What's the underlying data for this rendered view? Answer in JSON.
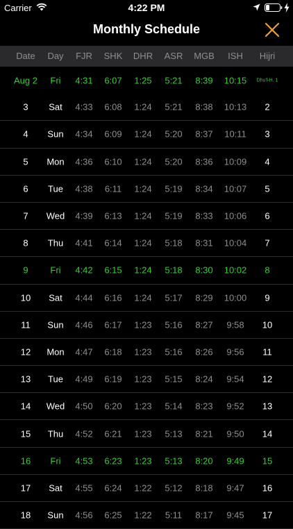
{
  "status": {
    "carrier": "Carrier",
    "time": "4:22 PM"
  },
  "nav": {
    "title": "Monthly Schedule"
  },
  "columns": [
    "Date",
    "Day",
    "FJR",
    "SHK",
    "DHR",
    "ASR",
    "MGB",
    "ISH",
    "Hijri"
  ],
  "rows": [
    {
      "date": "Aug 2",
      "day": "Fri",
      "fjr": "4:31",
      "shk": "6:07",
      "dhr": "1:25",
      "asr": "5:21",
      "mgb": "8:39",
      "ish": "10:15",
      "hijri": "Dhu'l-H. 1",
      "highlight": true
    },
    {
      "date": "3",
      "day": "Sat",
      "fjr": "4:33",
      "shk": "6:08",
      "dhr": "1:24",
      "asr": "5:21",
      "mgb": "8:38",
      "ish": "10:13",
      "hijri": "2"
    },
    {
      "date": "4",
      "day": "Sun",
      "fjr": "4:34",
      "shk": "6:09",
      "dhr": "1:24",
      "asr": "5:20",
      "mgb": "8:37",
      "ish": "10:11",
      "hijri": "3"
    },
    {
      "date": "5",
      "day": "Mon",
      "fjr": "4:36",
      "shk": "6:10",
      "dhr": "1:24",
      "asr": "5:20",
      "mgb": "8:36",
      "ish": "10:09",
      "hijri": "4"
    },
    {
      "date": "6",
      "day": "Tue",
      "fjr": "4:38",
      "shk": "6:11",
      "dhr": "1:24",
      "asr": "5:19",
      "mgb": "8:34",
      "ish": "10:07",
      "hijri": "5"
    },
    {
      "date": "7",
      "day": "Wed",
      "fjr": "4:39",
      "shk": "6:13",
      "dhr": "1:24",
      "asr": "5:19",
      "mgb": "8:33",
      "ish": "10:06",
      "hijri": "6"
    },
    {
      "date": "8",
      "day": "Thu",
      "fjr": "4:41",
      "shk": "6:14",
      "dhr": "1:24",
      "asr": "5:18",
      "mgb": "8:31",
      "ish": "10:04",
      "hijri": "7"
    },
    {
      "date": "9",
      "day": "Fri",
      "fjr": "4:42",
      "shk": "6:15",
      "dhr": "1:24",
      "asr": "5:18",
      "mgb": "8:30",
      "ish": "10:02",
      "hijri": "8",
      "highlight": true
    },
    {
      "date": "10",
      "day": "Sat",
      "fjr": "4:44",
      "shk": "6:16",
      "dhr": "1:24",
      "asr": "5:17",
      "mgb": "8:29",
      "ish": "10:00",
      "hijri": "9"
    },
    {
      "date": "11",
      "day": "Sun",
      "fjr": "4:46",
      "shk": "6:17",
      "dhr": "1:23",
      "asr": "5:16",
      "mgb": "8:27",
      "ish": "9:58",
      "hijri": "10"
    },
    {
      "date": "12",
      "day": "Mon",
      "fjr": "4:47",
      "shk": "6:18",
      "dhr": "1:23",
      "asr": "5:16",
      "mgb": "8:26",
      "ish": "9:56",
      "hijri": "11"
    },
    {
      "date": "13",
      "day": "Tue",
      "fjr": "4:49",
      "shk": "6:19",
      "dhr": "1:23",
      "asr": "5:15",
      "mgb": "8:24",
      "ish": "9:54",
      "hijri": "12"
    },
    {
      "date": "14",
      "day": "Wed",
      "fjr": "4:50",
      "shk": "6:20",
      "dhr": "1:23",
      "asr": "5:14",
      "mgb": "8:23",
      "ish": "9:52",
      "hijri": "13"
    },
    {
      "date": "15",
      "day": "Thu",
      "fjr": "4:52",
      "shk": "6:21",
      "dhr": "1:23",
      "asr": "5:13",
      "mgb": "8:21",
      "ish": "9:50",
      "hijri": "14"
    },
    {
      "date": "16",
      "day": "Fri",
      "fjr": "4:53",
      "shk": "6:23",
      "dhr": "1:23",
      "asr": "5:13",
      "mgb": "8:20",
      "ish": "9:49",
      "hijri": "15",
      "highlight": true
    },
    {
      "date": "17",
      "day": "Sat",
      "fjr": "4:55",
      "shk": "6:24",
      "dhr": "1:22",
      "asr": "5:12",
      "mgb": "8:18",
      "ish": "9:47",
      "hijri": "16"
    },
    {
      "date": "18",
      "day": "Sun",
      "fjr": "4:56",
      "shk": "6:25",
      "dhr": "1:22",
      "asr": "5:11",
      "mgb": "8:17",
      "ish": "9:45",
      "hijri": "17"
    }
  ],
  "colors": {
    "highlight": "#31d12c",
    "accent": "#f0a030",
    "background": "#000000",
    "header_bg": "#2a2a2c",
    "muted": "#8e8e93"
  },
  "icons": {
    "wifi": "wifi-icon",
    "location": "location-arrow-icon",
    "battery": "battery-icon",
    "charging": "charging-bolt-icon",
    "close": "close-icon"
  }
}
